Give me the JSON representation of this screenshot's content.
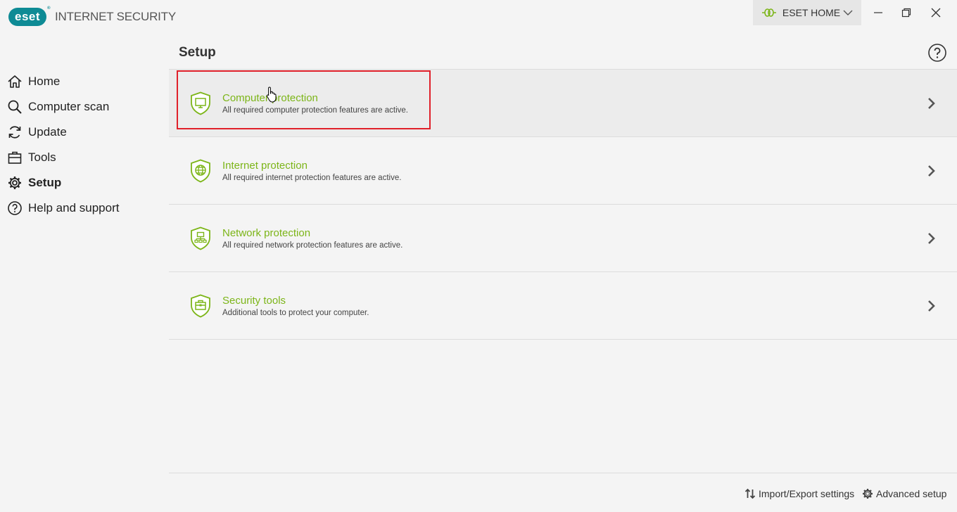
{
  "app": {
    "logo_text": "eset",
    "logo_mark": "®",
    "product_name": "INTERNET SECURITY"
  },
  "header": {
    "eset_home_label": "ESET HOME",
    "window_controls": [
      "minimize-icon",
      "restore-icon",
      "close-icon"
    ]
  },
  "sidebar": {
    "items": [
      {
        "label": "Home",
        "icon": "home-icon",
        "active": false
      },
      {
        "label": "Computer scan",
        "icon": "search-icon",
        "active": false
      },
      {
        "label": "Update",
        "icon": "refresh-icon",
        "active": false
      },
      {
        "label": "Tools",
        "icon": "briefcase-icon",
        "active": false
      },
      {
        "label": "Setup",
        "icon": "gear-icon",
        "active": true
      },
      {
        "label": "Help and support",
        "icon": "question-icon",
        "active": false
      }
    ]
  },
  "main": {
    "title": "Setup",
    "items": [
      {
        "title": "Computer protection",
        "description": "All required computer protection features are active.",
        "icon": "monitor-shield-icon"
      },
      {
        "title": "Internet protection",
        "description": "All required internet protection features are active.",
        "icon": "globe-shield-icon"
      },
      {
        "title": "Network protection",
        "description": "All required network protection features are active.",
        "icon": "network-shield-icon"
      },
      {
        "title": "Security tools",
        "description": "Additional tools to protect your computer.",
        "icon": "toolbox-shield-icon"
      }
    ]
  },
  "footer": {
    "import_export_label": "Import/Export settings",
    "advanced_setup_label": "Advanced setup"
  },
  "colors": {
    "accent_green": "#7cb518",
    "brand_teal": "#0e8b95",
    "highlight_red": "#e0202a"
  }
}
